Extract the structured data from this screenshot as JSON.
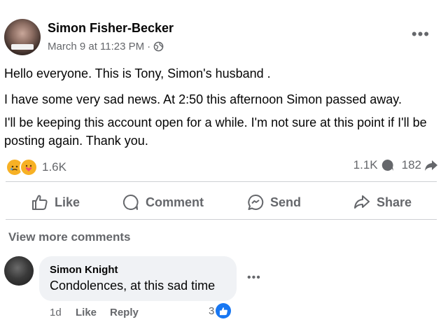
{
  "post": {
    "author": "Simon Fisher-Becker",
    "timestamp": "March 9 at 11:23 PM",
    "meta_separator": "·",
    "audience_icon": "globe-icon",
    "more_icon": "more-options-icon",
    "body": {
      "line1": "Hello everyone.  This is Tony, Simon's husband .",
      "line2": "I have some very sad news.  At 2:50 this afternoon Simon passed away.",
      "line3": "I'll be keeping this account open for a while.  I'm not sure at this point if I'll be posting again. Thank you."
    },
    "reactions": {
      "icons": [
        "sad-reaction-icon",
        "care-reaction-icon"
      ],
      "count": "1.6K"
    },
    "comments_count": "1.1K",
    "shares_count": "182"
  },
  "actions": {
    "like": "Like",
    "comment": "Comment",
    "send": "Send",
    "share": "Share"
  },
  "view_more_comments": "View more comments",
  "comment": {
    "author": "Simon Knight",
    "text": "Condolences, at this sad time",
    "time": "1d",
    "like_label": "Like",
    "reply_label": "Reply",
    "reaction_count": "3",
    "reaction_icon": "like-reaction-icon"
  },
  "colors": {
    "text_primary": "#050505",
    "text_secondary": "#65676b",
    "bubble": "#f0f2f5",
    "like_blue": "#1877f2",
    "reaction_yellow": "#f7b125",
    "divider": "#ced0d4"
  }
}
